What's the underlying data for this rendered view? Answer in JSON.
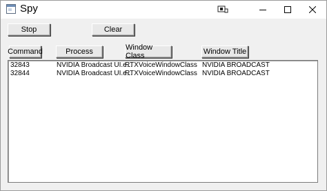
{
  "window": {
    "title": "Spy"
  },
  "toolbar": {
    "stop_label": "Stop",
    "clear_label": "Clear"
  },
  "columns": [
    {
      "label": "Command"
    },
    {
      "label": "Process"
    },
    {
      "label": "Window Class"
    },
    {
      "label": "Window Title"
    }
  ],
  "rows": [
    {
      "command": "32843",
      "process": "NVIDIA Broadcast UI.e...",
      "window_class": "RTXVoiceWindowClass",
      "window_title": "NVIDIA BROADCAST"
    },
    {
      "command": "32844",
      "process": "NVIDIA Broadcast UI.e...",
      "window_class": "RTXVoiceWindowClass",
      "window_title": "NVIDIA BROADCAST"
    }
  ],
  "icons": [
    "app-icon",
    "cast-icon",
    "minimize-icon",
    "maximize-icon",
    "close-icon"
  ]
}
